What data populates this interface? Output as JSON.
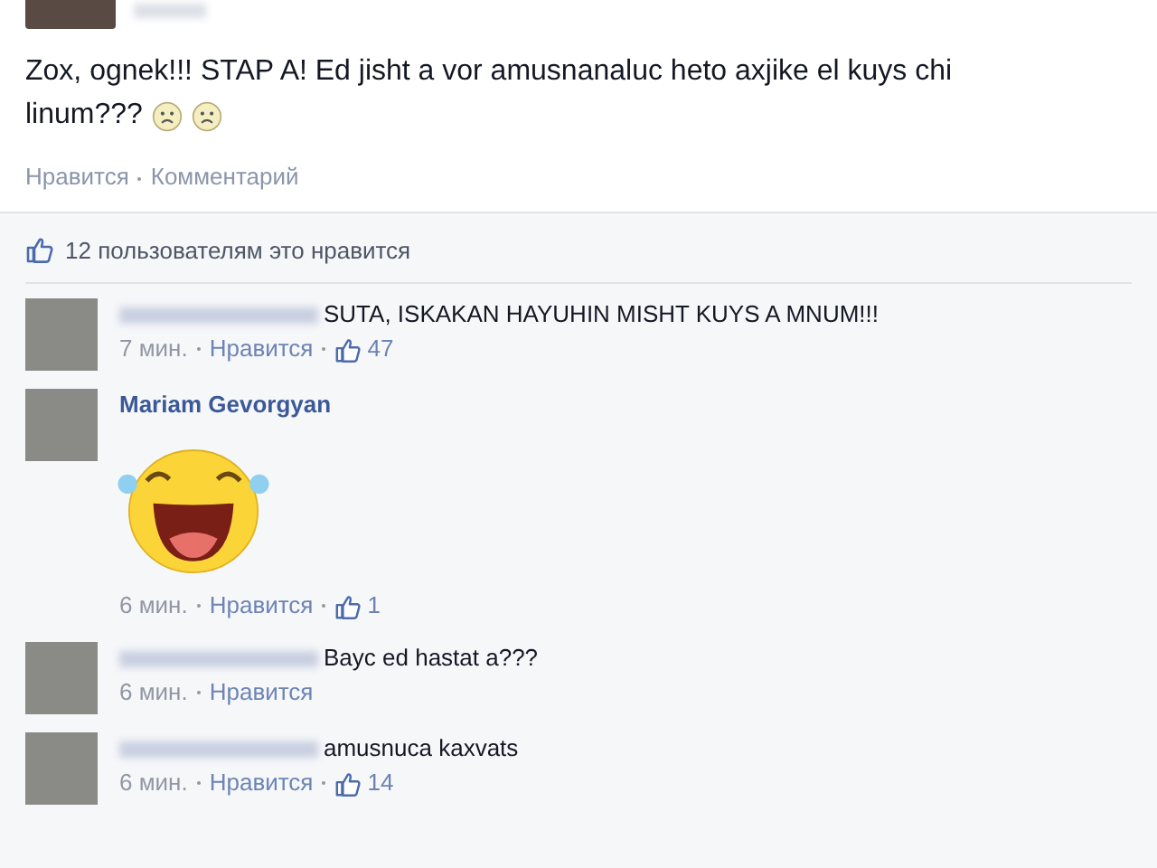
{
  "post": {
    "text_lines": [
      "Zox, ognek!!! STAP A! Ed jisht a vor amusnanaluc heto axjike el kuys chi",
      "linum???"
    ],
    "emoji": [
      {
        "kind": "sad"
      },
      {
        "kind": "sad"
      }
    ],
    "actions": [
      "Нравится",
      "Комментарий"
    ],
    "likes_summary": "12 пользователям это нравится"
  },
  "comments": [
    {
      "kind": "text",
      "name_blurred": true,
      "text": "SUTA, ISKAKAN HAYUHIN MISHT KUYS A MNUM!!!",
      "time": "7 мин.",
      "like": "Нравится",
      "likes": "47"
    },
    {
      "kind": "sticker",
      "name": "Mariam Gevorgyan",
      "time": "6 мин.",
      "like": "Нравится",
      "likes": "1"
    },
    {
      "kind": "text",
      "name_blurred": true,
      "text": "Bayc ed hastat a???",
      "time": "6 мин.",
      "like": "Нравится"
    },
    {
      "kind": "text",
      "name_blurred": true,
      "text": "amusnuca kaxvats",
      "time": "6 мин.",
      "like": "Нравится",
      "likes": "14"
    }
  ]
}
